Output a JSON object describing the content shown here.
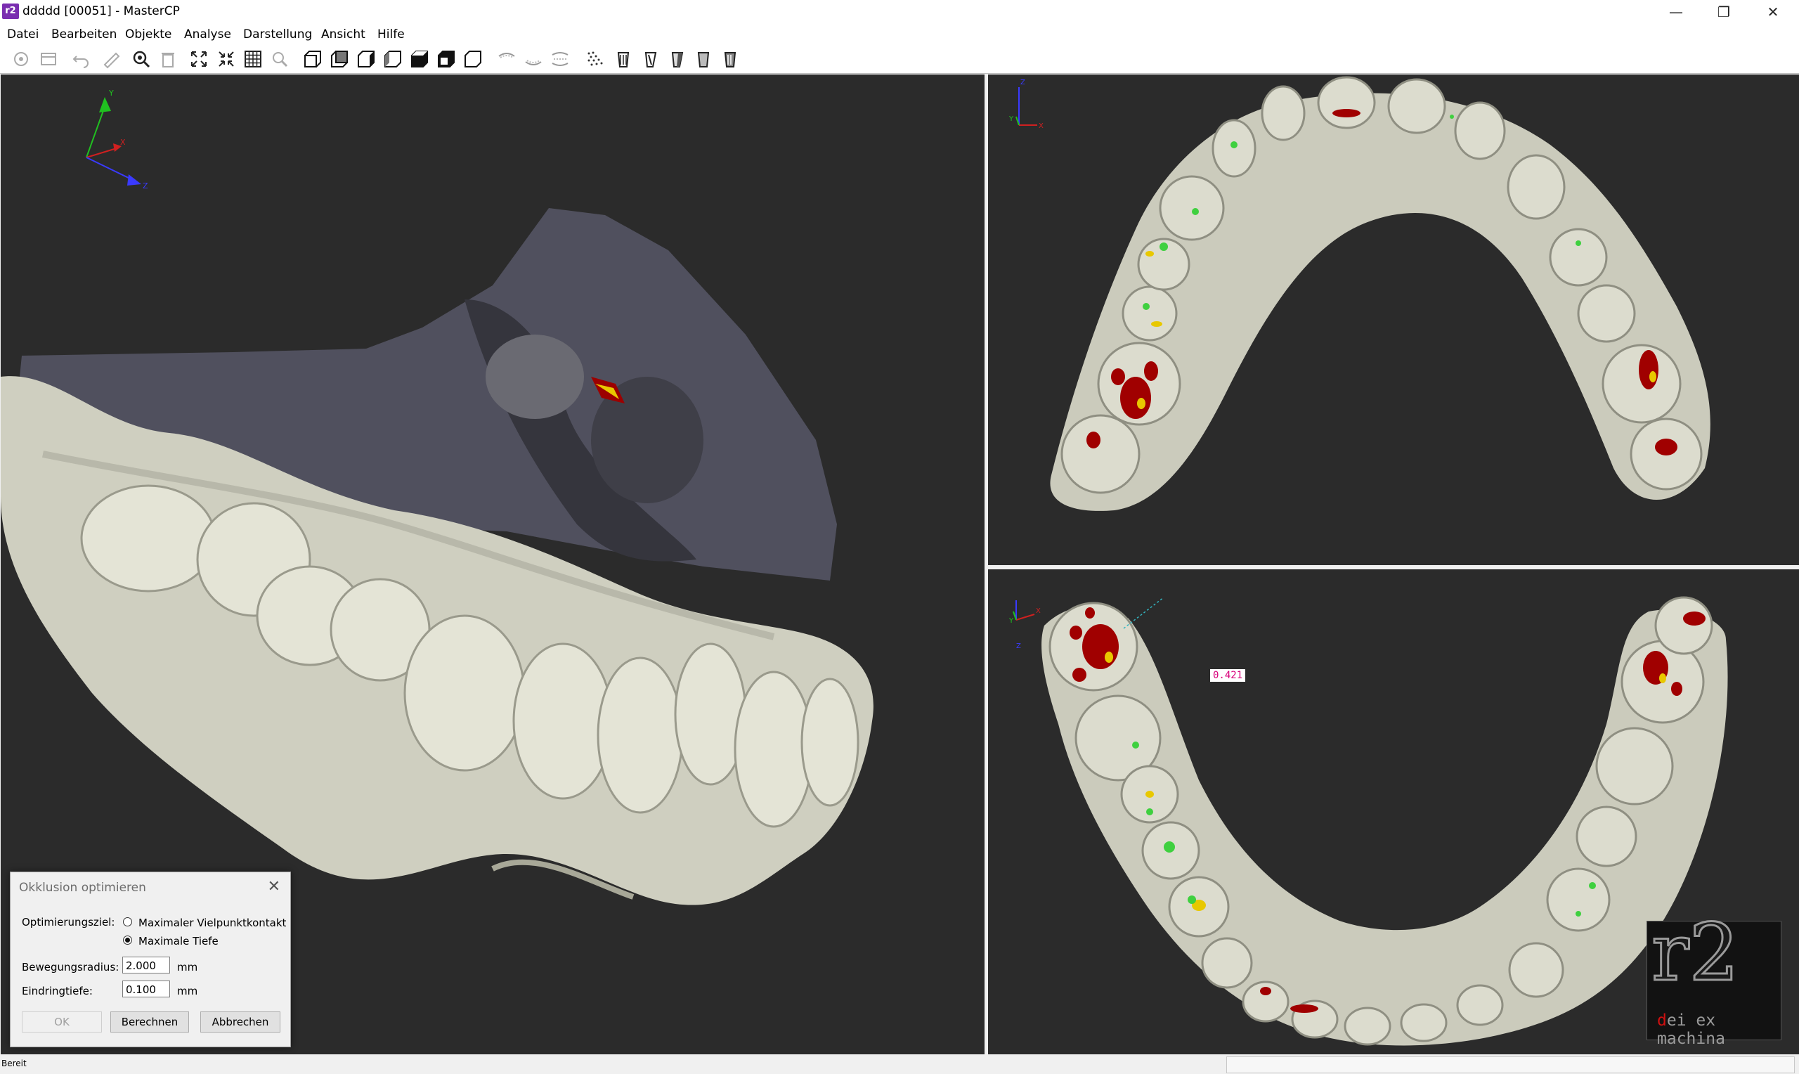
{
  "window": {
    "app_icon_text": "r2",
    "title": "ddddd [00051] - MasterCP",
    "controls": {
      "minimize": "—",
      "restore": "❐",
      "close": "✕"
    }
  },
  "menu": [
    "Datei",
    "Bearbeiten",
    "Objekte",
    "Analyse",
    "Darstellung",
    "Ansicht",
    "Hilfe"
  ],
  "toolbar": {
    "buttons": [
      "settings-icon",
      "archive-icon",
      "undo-icon",
      "measure-icon",
      "zoom-search-icon",
      "delete-icon",
      "zoom-extents-icon",
      "zoom-in-icon",
      "grid-icon",
      "magnifier-icon",
      "view-front-icon",
      "view-back-icon",
      "view-left-icon",
      "view-right-icon",
      "view-top-icon",
      "view-bottom-icon",
      "view-iso-icon",
      "upper-jaw-icon",
      "lower-jaw-icon",
      "both-jaws-icon",
      "points-icon",
      "tooth-solid-icon",
      "tooth-wire-icon",
      "tooth-shaded-icon",
      "tooth-transparent-icon",
      "tooth-all-icon"
    ]
  },
  "viewports": {
    "main_axes": {
      "x": "X",
      "y": "Y",
      "z": "Z"
    },
    "upper_axes": {
      "x": "X",
      "y": "Y",
      "z": "Z"
    },
    "lower_axes": {
      "x": "X",
      "y": "Y",
      "z": "Z"
    },
    "distance_label": "0.421"
  },
  "dialog": {
    "title": "Okklusion optimieren",
    "goal_label": "Optimierungsziel:",
    "options": [
      {
        "label": "Maximaler Vielpunktkontakt",
        "checked": false
      },
      {
        "label": "Maximale Tiefe",
        "checked": true
      }
    ],
    "radius_label": "Bewegungsradius:",
    "radius_value": "2.000",
    "radius_unit": "mm",
    "depth_label": "Eindringtiefe:",
    "depth_value": "0.100",
    "depth_unit": "mm",
    "ok_label": "OK",
    "calc_label": "Berechnen",
    "cancel_label": "Abbrechen"
  },
  "logo": {
    "big": "r2",
    "sub_first": "d",
    "sub_rest": "ei ex machina"
  },
  "status": {
    "text": "Bereit"
  }
}
